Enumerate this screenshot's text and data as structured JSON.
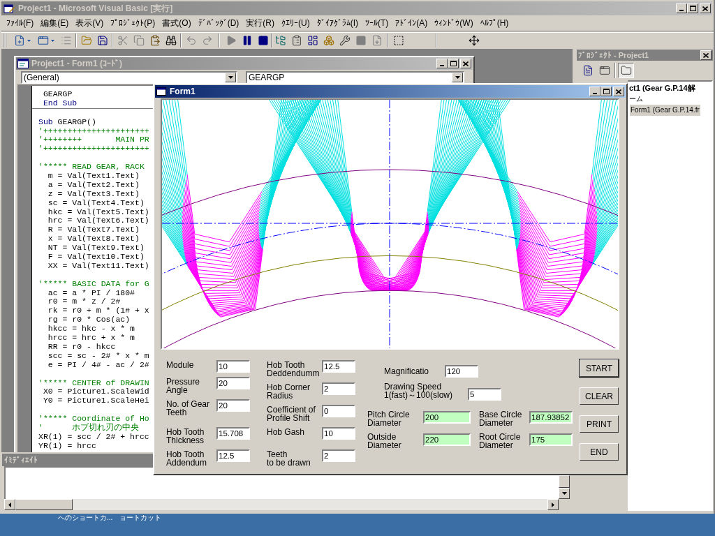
{
  "main_window": {
    "title": "Project1 - Microsoft Visual Basic [実行]",
    "active": false
  },
  "menu": [
    "ﾌｧｲﾙ(F)",
    "編集(E)",
    "表示(V)",
    "ﾌﾟﾛｼﾞｪｸﾄ(P)",
    "書式(O)",
    "ﾃﾞﾊﾞｯｸﾞ(D)",
    "実行(R)",
    "ｸｴﾘｰ(U)",
    "ﾀﾞｲｱｸﾞﾗﾑ(I)",
    "ﾂｰﾙ(T)",
    "ｱﾄﾞｲﾝ(A)",
    "ｳｨﾝﾄﾞｳ(W)",
    "ﾍﾙﾌﾟ(H)"
  ],
  "toolbar": [
    {
      "disabled": false
    },
    {
      "disabled": false
    },
    {
      "disabled": true
    },
    {
      "disabled": false
    },
    {
      "disabled": false
    },
    {
      "disabled": true
    },
    {
      "disabled": true
    },
    {
      "disabled": false
    },
    {
      "disabled": false
    },
    {
      "disabled": true
    },
    {
      "disabled": true
    },
    {
      "disabled": true
    },
    {
      "disabled": false
    },
    {
      "disabled": false
    },
    {
      "disabled": false
    },
    {
      "disabled": false
    },
    {
      "disabled": false
    },
    {
      "disabled": false
    },
    {
      "disabled": false
    },
    {
      "disabled": true
    },
    {
      "disabled": true
    },
    {
      "disabled": false
    },
    {
      "disabled": false
    }
  ],
  "code_window": {
    "title": "Project1 - Form1 (ｺｰﾄﾞ)",
    "active": false,
    "object": "(General)",
    "procedure": "GEARGP",
    "procedures": [
      {
        "blocks": [
          [
            {
              "parts": [
                {
                  "kind": "code",
                  "text": " GEARGP"
                }
              ]
            },
            {
              "parts": [
                {
                  "kind": "keyword",
                  "text": " End Sub"
                }
              ]
            }
          ]
        ]
      },
      {
        "blocks": [
          [
            {
              "parts": [
                {
                  "kind": "keyword",
                  "text": "Sub"
                },
                {
                  "kind": "code",
                  "text": " GEARGP()"
                }
              ]
            },
            {
              "parts": [
                {
                  "kind": "comment",
                  "text": "'++++++++++++++++++++++"
                }
              ]
            },
            {
              "parts": [
                {
                  "kind": "comment",
                  "text": "'++++++++       MAIN PR"
                }
              ]
            },
            {
              "parts": [
                {
                  "kind": "comment",
                  "text": "'++++++++++++++++++++++"
                }
              ]
            }
          ],
          [
            {
              "parts": [
                {
                  "kind": "comment",
                  "text": "'***** READ GEAR, RACK"
                }
              ]
            },
            {
              "parts": [
                {
                  "kind": "code",
                  "text": "  m = Val(Text1.Text)"
                }
              ]
            },
            {
              "parts": [
                {
                  "kind": "code",
                  "text": "  a = Val(Text2.Text)"
                }
              ]
            },
            {
              "parts": [
                {
                  "kind": "code",
                  "text": "  z = Val(Text3.Text)"
                }
              ]
            },
            {
              "parts": [
                {
                  "kind": "code",
                  "text": "  sc = Val(Text4.Text)"
                }
              ]
            },
            {
              "parts": [
                {
                  "kind": "code",
                  "text": "  hkc = Val(Text5.Text)"
                }
              ]
            },
            {
              "parts": [
                {
                  "kind": "code",
                  "text": "  hrc = Val(Text6.Text)"
                }
              ]
            },
            {
              "parts": [
                {
                  "kind": "code",
                  "text": "  R = Val(Text7.Text)"
                }
              ]
            },
            {
              "parts": [
                {
                  "kind": "code",
                  "text": "  x = Val(Text8.Text)"
                }
              ]
            },
            {
              "parts": [
                {
                  "kind": "code",
                  "text": "  NT = Val(Text9.Text)"
                }
              ]
            },
            {
              "parts": [
                {
                  "kind": "code",
                  "text": "  F = Val(Text10.Text)"
                }
              ]
            },
            {
              "parts": [
                {
                  "kind": "code",
                  "text": "  XX = Val(Text11.Text)"
                }
              ]
            }
          ],
          [
            {
              "parts": [
                {
                  "kind": "comment",
                  "text": "'***** BASIC DATA for G"
                }
              ]
            },
            {
              "parts": [
                {
                  "kind": "code",
                  "text": "  ac = a * PI / 180#"
                }
              ]
            },
            {
              "parts": [
                {
                  "kind": "code",
                  "text": "  r0 = m * z / 2#"
                }
              ]
            },
            {
              "parts": [
                {
                  "kind": "code",
                  "text": "  rk = r0 + m * (1# + x"
                }
              ]
            },
            {
              "parts": [
                {
                  "kind": "code",
                  "text": "  rg = r0 * Cos(ac)"
                }
              ]
            },
            {
              "parts": [
                {
                  "kind": "code",
                  "text": "  hkcc = hkc - x * m"
                }
              ]
            },
            {
              "parts": [
                {
                  "kind": "code",
                  "text": "  hrcc = hrc + x * m"
                }
              ]
            },
            {
              "parts": [
                {
                  "kind": "code",
                  "text": "  RR = r0 - hkcc"
                }
              ]
            },
            {
              "parts": [
                {
                  "kind": "code",
                  "text": "  scc = sc - 2# * x * m"
                }
              ]
            },
            {
              "parts": [
                {
                  "kind": "code",
                  "text": "  e = PI / 4# - ac / 2#"
                }
              ]
            }
          ],
          [
            {
              "parts": [
                {
                  "kind": "comment",
                  "text": "'***** CENTER of DRAWIN"
                }
              ]
            },
            {
              "parts": [
                {
                  "kind": "code",
                  "text": " X0 = Picture1.ScaleWid"
                }
              ]
            },
            {
              "parts": [
                {
                  "kind": "code",
                  "text": " Y0 = Picture1.ScaleHei"
                }
              ]
            }
          ],
          [
            {
              "parts": [
                {
                  "kind": "comment",
                  "text": "'***** Coordinate of Ho"
                }
              ]
            },
            {
              "parts": [
                {
                  "kind": "comment",
                  "text": "'      ホブ切れ刃の中央"
                }
              ]
            },
            {
              "parts": [
                {
                  "kind": "code",
                  "text": "XR(1) = scc / 2# + hrcc"
                }
              ]
            },
            {
              "parts": [
                {
                  "kind": "code",
                  "text": "YR(1) = hrcc"
                }
              ]
            }
          ]
        ]
      }
    ]
  },
  "immediate_window": {
    "title": "ｲﾐﾃﾞｨｴｲﾄ",
    "active": false
  },
  "project_explorer": {
    "title": "ﾌﾟﾛｼﾞｪｸﾄ - Project1",
    "active": false,
    "toolbar": [
      {
        "pressed": false
      },
      {
        "pressed": false
      },
      {
        "pressed": true
      }
    ],
    "tree": [
      {
        "label": "ct1 (Gear G.P.14解",
        "selected": false,
        "children": [
          {
            "label": "ーム",
            "selected": false,
            "children": [
              {
                "label": "Form1 (Gear G.P.14.fr",
                "selected": true
              }
            ]
          }
        ]
      }
    ]
  },
  "form": {
    "title": "Form1",
    "active": true,
    "parameter_columns": [
      [
        {
          "label": "Module",
          "value": "10"
        },
        {
          "label": "Pressure\nAngle",
          "value": "20"
        },
        {
          "label": "No. of Gear\nTeeth",
          "value": "20"
        },
        {
          "label": "Hob Tooth\nThickness",
          "value": "15.708"
        },
        {
          "label": "Hob Tooth\nAddendum",
          "value": "12.5"
        }
      ],
      [
        {
          "label": "Hob Tooth\nDeddendumm",
          "value": "12.5"
        },
        {
          "label": "Hob Corner\nRadius",
          "value": "2"
        },
        {
          "label": "Coefficient of\nProfile Shift",
          "value": "0"
        },
        {
          "label": "Hob Gash",
          "value": "10"
        },
        {
          "label": "Teeth\nto be drawn",
          "value": "2"
        }
      ]
    ],
    "settings": [
      {
        "label": "Magnificatio",
        "value": "120"
      },
      {
        "label": "Drawing Speed\n1(fast)～100(slow)",
        "value": "5"
      }
    ],
    "results": [
      {
        "label": "Pitch Circle\nDiameter",
        "value": "200",
        "readonly": true
      },
      {
        "label": "Base Circle\nDiameter",
        "value": "187.93852",
        "readonly": true
      },
      {
        "label": "Outside\nDiameter",
        "value": "220",
        "readonly": true
      },
      {
        "label": "Root Circle\nDiameter",
        "value": "175",
        "readonly": true
      }
    ],
    "buttons": [
      {
        "label": "START",
        "focused": true
      },
      {
        "label": "CLEAR",
        "focused": false
      },
      {
        "label": "PRINT",
        "focused": false
      },
      {
        "label": "END",
        "focused": false
      }
    ]
  },
  "desktop_icons": [
    {
      "label": "へのショートカ..."
    },
    {
      "label": "ョートカット"
    }
  ]
}
